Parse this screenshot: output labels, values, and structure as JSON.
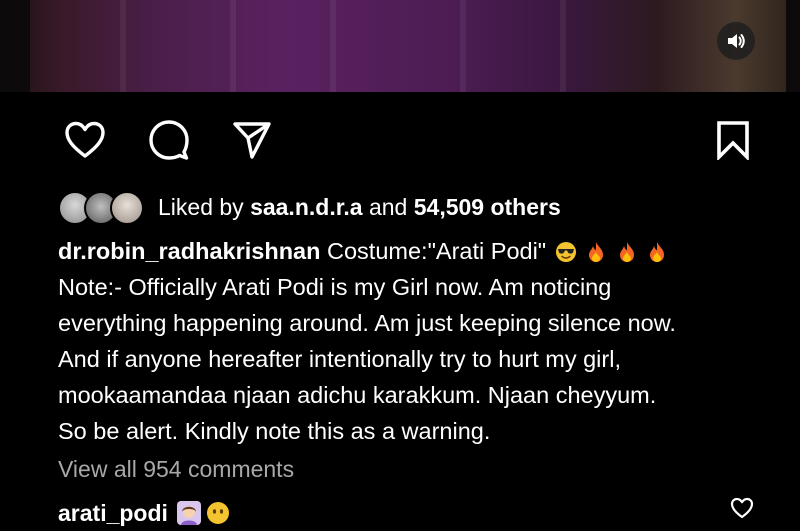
{
  "post": {
    "sound_icon": "speaker-icon",
    "actions": {
      "like_icon": "heart-icon",
      "comment_icon": "comment-bubble-icon",
      "share_icon": "paper-plane-icon",
      "save_icon": "bookmark-icon"
    },
    "likes": {
      "prefix": "Liked by",
      "user": "saa.n.d.r.a",
      "middle": "and",
      "count_text": "54,509 others"
    },
    "caption": {
      "username": "dr.robin_radhakrishnan",
      "title": "Costume:\"Arati Podi\"",
      "title_emojis": [
        "sunglasses-face",
        "fire",
        "fire",
        "fire"
      ],
      "lines": [
        "Note:- Officially Arati Podi is my Girl now. Am noticing",
        "everything happening around. Am just keeping silence now.",
        "And if anyone hereafter intentionally try to hurt my girl,",
        "mookaamandaa njaan adichu karakkum. Njaan cheyyum.",
        "So be alert. Kindly note this as a warning."
      ]
    },
    "view_comments": "View all 954 comments",
    "comment": {
      "username": "arati_podi",
      "emojis": [
        "woman-raising-hand",
        "face-without-mouth"
      ],
      "like_icon": "heart-icon"
    }
  }
}
